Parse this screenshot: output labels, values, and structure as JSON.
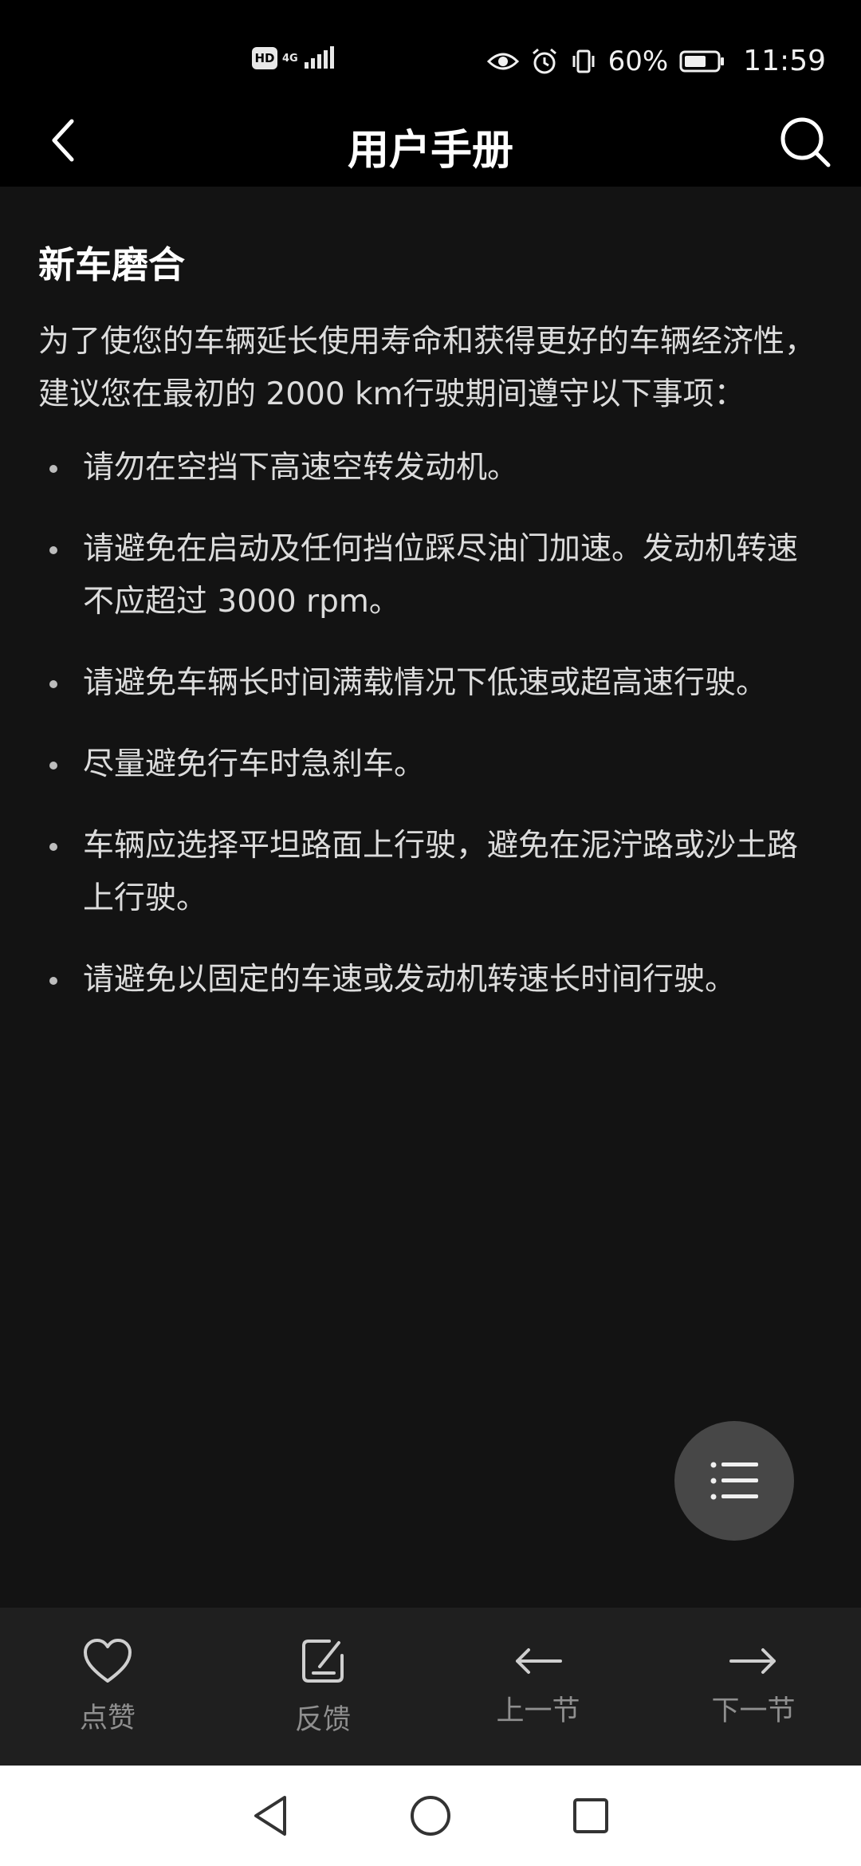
{
  "status_bar": {
    "hd": "HD",
    "network": "4G",
    "battery": "60%",
    "time": "11:59"
  },
  "app_bar": {
    "title": "用户手册"
  },
  "article": {
    "heading": "新车磨合",
    "intro": "为了使您的车辆延长使用寿命和获得更好的车辆经济性，建议您在最初的 2000 km行驶期间遵守以下事项：",
    "bullets": [
      "请勿在空挡下高速空转发动机。",
      "请避免在启动及任何挡位踩尽油门加速。发动机转速不应超过 3000 rpm。",
      "请避免车辆长时间满载情况下低速或超高速行驶。",
      "尽量避免行车时急刹车。",
      "车辆应选择平坦路面上行驶，避免在泥泞路或沙土路上行驶。",
      "请避免以固定的车速或发动机转速长时间行驶。"
    ]
  },
  "bottom_bar": {
    "like": "点赞",
    "feedback": "反馈",
    "prev": "上一节",
    "next": "下一节"
  }
}
